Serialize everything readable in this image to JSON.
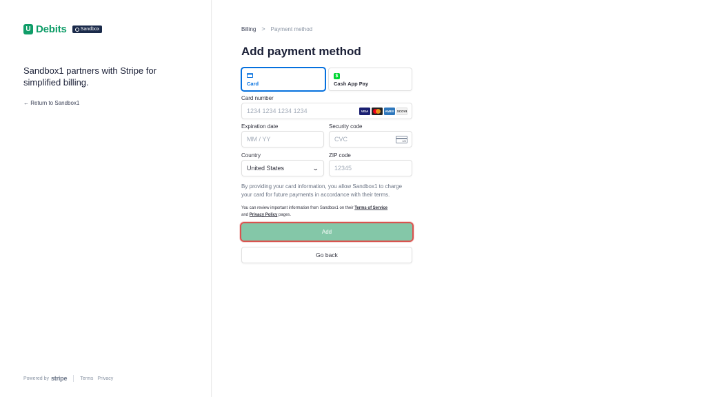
{
  "brand": {
    "name": "Debits",
    "badge": "Sandbox",
    "logo_letter": "U"
  },
  "left": {
    "tagline": "Sandbox1 partners with Stripe for simplified billing.",
    "return_link": "← Return to Sandbox1"
  },
  "footer": {
    "powered_by": "Powered by",
    "stripe": "stripe",
    "terms": "Terms",
    "privacy": "Privacy"
  },
  "breadcrumb": {
    "first": "Billing",
    "separator": ">",
    "current": "Payment method"
  },
  "title": "Add payment method",
  "methods": [
    {
      "label": "Card",
      "icon": "card-icon",
      "selected": true
    },
    {
      "label": "Cash App Pay",
      "icon": "cash-app-icon",
      "selected": false
    }
  ],
  "form": {
    "card_number": {
      "label": "Card number",
      "placeholder": "1234 1234 1234 1234",
      "brands": [
        "VISA",
        "mastercard",
        "AMEX",
        "DISCOVER"
      ]
    },
    "expiration": {
      "label": "Expiration date",
      "placeholder": "MM / YY"
    },
    "security_code": {
      "label": "Security code",
      "placeholder": "CVC"
    },
    "country": {
      "label": "Country",
      "value": "United States"
    },
    "zip": {
      "label": "ZIP code",
      "placeholder": "12345"
    }
  },
  "consent": "By providing your card information, you allow Sandbox1 to charge your card for future payments in accordance with their terms.",
  "review": {
    "prefix": "You can review important information from Sandbox1 on their ",
    "terms_link": "Terms of Service",
    "middle": " and ",
    "privacy_link": "Privacy Policy",
    "suffix": " pages."
  },
  "buttons": {
    "add": "Add",
    "back": "Go back"
  },
  "colors": {
    "brand_green": "#0f9d68",
    "accent_blue": "#0570de",
    "add_button": "#84c7a8",
    "focus_ring": "#d9534f"
  }
}
